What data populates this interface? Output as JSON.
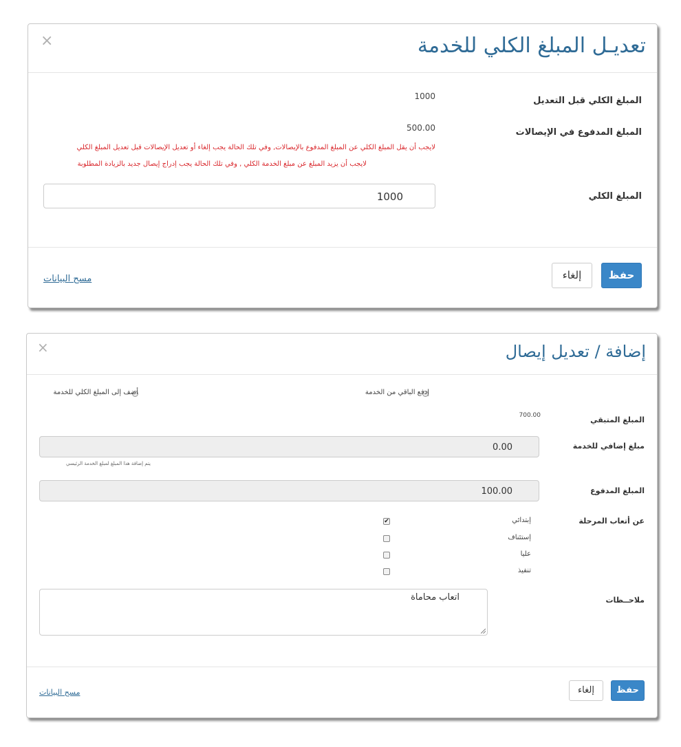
{
  "modal1": {
    "title": "تعديـل المبلغ الكلي للخدمة",
    "close_symbol": "×",
    "before_edit_label": "المبلغ الكلي قبل التعديل",
    "before_edit_value": "1000",
    "paid_label": "المبلغ المدفوع في الإيصالات",
    "paid_value": "500.00",
    "error_1": "لايجب أن يقل المبلغ الكلي عن المبلغ المدفوع بالإيصالات, وفي تلك الحالة يجب إلغاء أو تعديل الإيصالات قبل تعديل المبلغ الكلي",
    "error_2": "لايجب أن يزيد المبلغ عن مبلغ الخدمة الكلي , وفي تلك الحالة يجب إدراج إيصال جديد بالزيادة المطلوبة",
    "total_label": "المبلغ الكلي",
    "total_value": "1000",
    "save_label": "حفظ",
    "cancel_label": "إلغاء",
    "clear_label": "مسح البيانات"
  },
  "modal2": {
    "title": "إضافة / تعديل إيصال",
    "close_symbol": "×",
    "radio_pay_remaining": "إدفع الباقي من الخدمة",
    "radio_add_total": "أضف إلى المبلغ الكلي للخدمة",
    "remaining_label": "المبلغ المتبقي",
    "remaining_value": "700.00",
    "extra_label": "مبلغ إضافي للخدمة",
    "extra_value": "0.00",
    "extra_help": "يتم إضافة هذا المبلغ لمبلغ الخدمة الرئيسي",
    "paid_label": "المبلغ المدفوع",
    "paid_value": "100.00",
    "stage_label": "عن أتعاب المرحلة",
    "stages": [
      {
        "label": "إبتدائي",
        "checked": true
      },
      {
        "label": "إستئناف",
        "checked": false
      },
      {
        "label": "عليا",
        "checked": false
      },
      {
        "label": "تنفيذ",
        "checked": false
      }
    ],
    "check_mark": "✔",
    "notes_label": "ملاحــظات",
    "notes_value": "اتعاب محاماة",
    "save_label": "حفظ",
    "cancel_label": "إلغاء",
    "clear_label": "مسح البيانات"
  }
}
